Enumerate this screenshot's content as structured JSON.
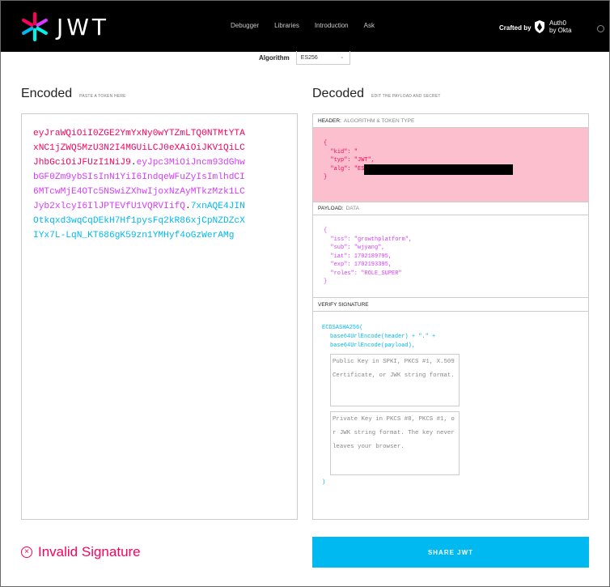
{
  "header": {
    "logo_text": "JWT",
    "nav": [
      "Debugger",
      "Libraries",
      "Introduction",
      "Ask"
    ],
    "crafted_by": "Crafted by",
    "auth0_line1": "Auth0",
    "auth0_line2": "by Okta"
  },
  "algorithm": {
    "label": "Algorithm",
    "value": "ES256"
  },
  "encoded": {
    "title": "Encoded",
    "subtitle": "PASTE A TOKEN HERE",
    "lines": [
      {
        "segments": [
          {
            "text": "eyJraWQiOiI0ZGE2YmYxNy0wYTZmLTQ0NTMtYTA",
            "part": "header"
          }
        ]
      },
      {
        "segments": [
          {
            "text": "xNC1jZWQ5MzU3N2I4MGUiLCJ0eXAiOiJKV1QiLC",
            "part": "header"
          }
        ]
      },
      {
        "segments": [
          {
            "text": "JhbGciOiJFUzI1NiJ9",
            "part": "header"
          },
          {
            "text": ".",
            "part": "dot"
          },
          {
            "text": "eyJpc3MiOiJncm93dGhw",
            "part": "payload"
          }
        ]
      },
      {
        "segments": [
          {
            "text": "bGF0Zm9ybSIsInN1YiI6IndqeWFuZyIsImlhdCI",
            "part": "payload"
          }
        ]
      },
      {
        "segments": [
          {
            "text": "6MTcwMjE4OTc5NSwiZXhwIjoxNzAyMTkzMzk1LC",
            "part": "payload"
          }
        ]
      },
      {
        "segments": [
          {
            "text": "Jyb2xlcyI6IlJPTEVfU1VQRVIifQ",
            "part": "payload"
          },
          {
            "text": ".",
            "part": "dot"
          },
          {
            "text": "7xnAQE4JIN",
            "part": "signature"
          }
        ]
      },
      {
        "segments": [
          {
            "text": "Otkqxd3wqCqDEkH7Hf1pysFq2kR86xjCpNZDZcX",
            "part": "signature"
          }
        ]
      },
      {
        "segments": [
          {
            "text": "IYx7L-LqN_KT686gK59zn1YMHyf4oGzWerAMg",
            "part": "signature"
          }
        ]
      }
    ]
  },
  "decoded": {
    "title": "Decoded",
    "subtitle": "EDIT THE PAYLOAD AND SECRET",
    "header_panel": {
      "label": "HEADER:",
      "sublabel": "ALGORITHM & TOKEN TYPE",
      "lines": [
        "{",
        "  \"kid\": \"",
        "  \"typ\": \"JWT\",",
        "  \"alg\": \"ES256\"",
        "}"
      ]
    },
    "payload_panel": {
      "label": "PAYLOAD:",
      "sublabel": "DATA",
      "lines": [
        "{",
        "  \"iss\": \"growthplatform\",",
        "  \"sub\": \"wjyang\",",
        "  \"iat\": 1702189795,",
        "  \"exp\": 1702193395,",
        "  \"roles\": \"ROLE_SUPER\"",
        "}"
      ]
    },
    "verify_panel": {
      "label": "VERIFY SIGNATURE",
      "fn": "ECDSASHA256(",
      "line1": "base64UrlEncode(header) + \".\" +",
      "line2": "base64UrlEncode(payload),",
      "public_key_placeholder": "Public Key in SPKI, PKCS #1, X.509 Certificate, or JWK string format.",
      "private_key_placeholder": "Private Key in PKCS #8, PKCS #1, or JWK string format. The key never leaves your browser.",
      "close": ")"
    }
  },
  "status": {
    "text": "Invalid Signature",
    "color": "#fb015b"
  },
  "share_button": "SHARE JWT",
  "colors": {
    "header_part": "#fb015b",
    "payload_part": "#d63aff",
    "signature_part": "#00b9f1",
    "share_bg": "#00b9f1"
  }
}
